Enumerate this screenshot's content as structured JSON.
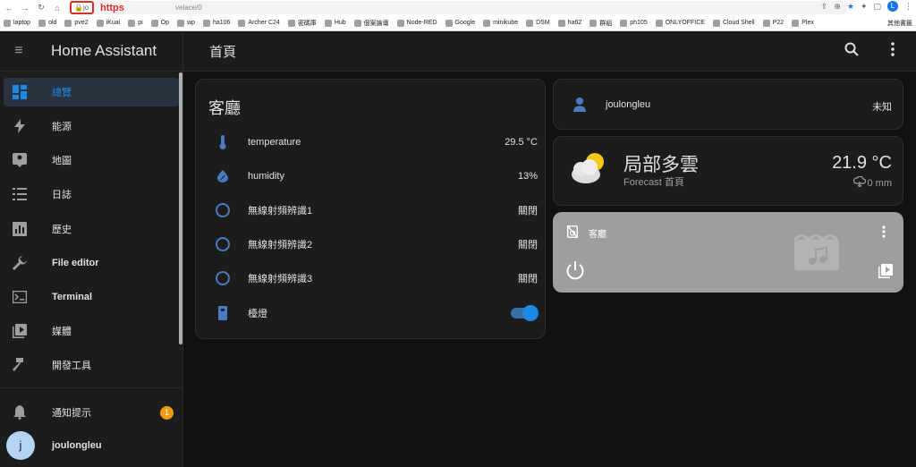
{
  "browser": {
    "url_host": "jo",
    "url_scheme": "https",
    "url_path": "velace/0",
    "profile_initial": "L",
    "other_bookmarks": "其他書籤",
    "bookmarks": [
      "laptop",
      "old",
      "pve2",
      "iKuai",
      "pi",
      "Op",
      "wp",
      "ha106",
      "Archer C24",
      "密碼庫",
      "Hub",
      "個案論壇",
      "Node-RED",
      "Google",
      "minikube",
      "DSM",
      "ha62",
      "群組",
      "ph105",
      "ONLYOFFICE",
      "Cloud Shell",
      "P22",
      "Plex"
    ]
  },
  "sidebar": {
    "title": "Home Assistant",
    "items": [
      {
        "label": "總覽",
        "icon": "dashboard-icon"
      },
      {
        "label": "能源",
        "icon": "lightning-icon"
      },
      {
        "label": "地圖",
        "icon": "map-icon"
      },
      {
        "label": "日誌",
        "icon": "logbook-icon"
      },
      {
        "label": "歷史",
        "icon": "history-icon"
      },
      {
        "label": "File editor",
        "icon": "wrench-icon"
      },
      {
        "label": "Terminal",
        "icon": "terminal-icon"
      },
      {
        "label": "媒體",
        "icon": "media-icon"
      },
      {
        "label": "開發工具",
        "icon": "hammer-icon"
      }
    ],
    "notifications": {
      "label": "通知提示",
      "count": "1"
    },
    "user": {
      "name": "joulongleu",
      "initial": "j"
    }
  },
  "topbar": {
    "title": "首頁"
  },
  "room_card": {
    "title": "客廳",
    "entities": [
      {
        "name": "temperature",
        "state": "29.5 °C",
        "icon": "thermometer-icon"
      },
      {
        "name": "humidity",
        "state": "13%",
        "icon": "humidity-icon"
      },
      {
        "name": "無線射頻辨識1",
        "state": "關閉",
        "icon": "circle-icon"
      },
      {
        "name": "無線射頻辨識2",
        "state": "關閉",
        "icon": "circle-icon"
      },
      {
        "name": "無線射頻辨識3",
        "state": "關閉",
        "icon": "circle-icon"
      },
      {
        "name": "檯燈",
        "state": "on",
        "icon": "lamp-icon"
      }
    ]
  },
  "person_card": {
    "name": "joulongleu",
    "state": "未知"
  },
  "weather_card": {
    "condition": "局部多雲",
    "subtitle": "Forecast 首頁",
    "temperature": "21.9 °C",
    "precipitation": "0 mm"
  },
  "media_card": {
    "title": "客廳"
  },
  "colors": {
    "accent": "#1e88e5",
    "entity_icon": "#4a7cbf",
    "badge": "#f39c12",
    "media_bg": "#9e9e9e"
  }
}
